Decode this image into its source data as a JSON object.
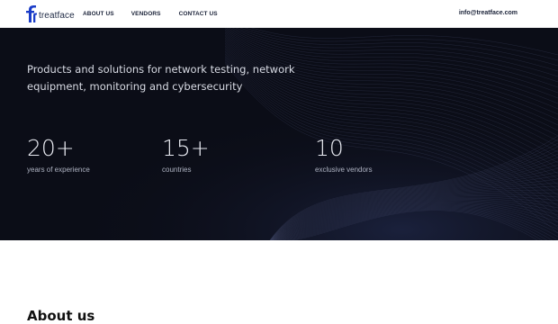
{
  "header": {
    "logo_text": "treatface",
    "nav": [
      "ABOUT US",
      "VENDORS",
      "CONTACT US"
    ],
    "email": "info@treatface.com"
  },
  "hero": {
    "tagline": "Products and solutions for network testing, network equipment, monitoring and cybersecurity",
    "stats": [
      {
        "value": "20+",
        "label": "years of experience"
      },
      {
        "value": "15+",
        "label": "countries"
      },
      {
        "value": "10",
        "label": "exclusive vendors"
      }
    ]
  },
  "about": {
    "heading": "About us"
  },
  "colors": {
    "hero_bg": "#0b0d17",
    "brand": "#1f2a44",
    "accent_blue": "#1a3cc8"
  }
}
